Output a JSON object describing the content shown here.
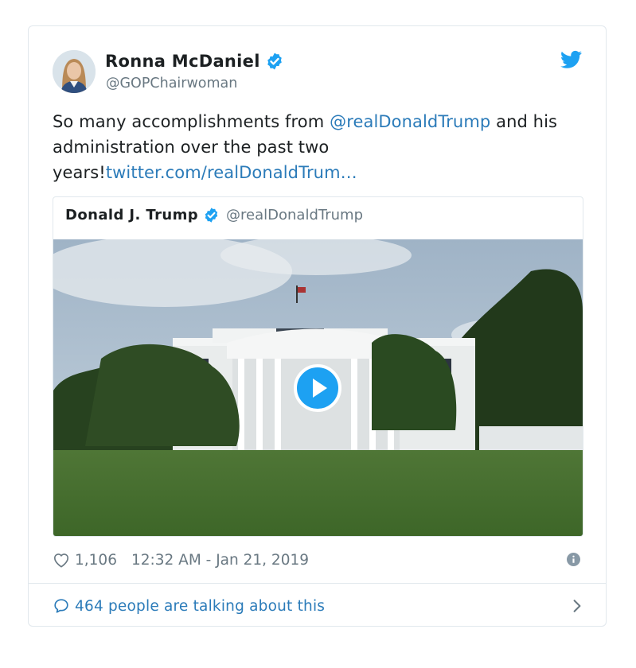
{
  "tweet": {
    "author_name": "Ronna McDaniel",
    "author_handle": "@GOPChairwoman",
    "text_prefix": "So many accomplishments from ",
    "mention": "@realDonaldTrump",
    "text_middle": " and his administration over the past two years!",
    "link": "twitter.com/realDonaldTrum…"
  },
  "quote": {
    "author_name": "Donald J. Trump",
    "author_handle": "@realDonaldTrump"
  },
  "footer": {
    "likes": "1,106",
    "timestamp": "12:32 AM - Jan 21, 2019",
    "talking": "464 people are talking about this"
  },
  "icons": {
    "verified": "verified-badge-icon",
    "twitter": "twitter-bird-icon",
    "play": "play-icon",
    "heart": "heart-icon",
    "info": "info-icon",
    "comment": "speech-bubble-icon",
    "chevron": "chevron-right-icon"
  },
  "colors": {
    "link": "#2b7bb9",
    "verified": "#1da1f2",
    "muted": "#697882",
    "border": "#e1e8ed"
  }
}
